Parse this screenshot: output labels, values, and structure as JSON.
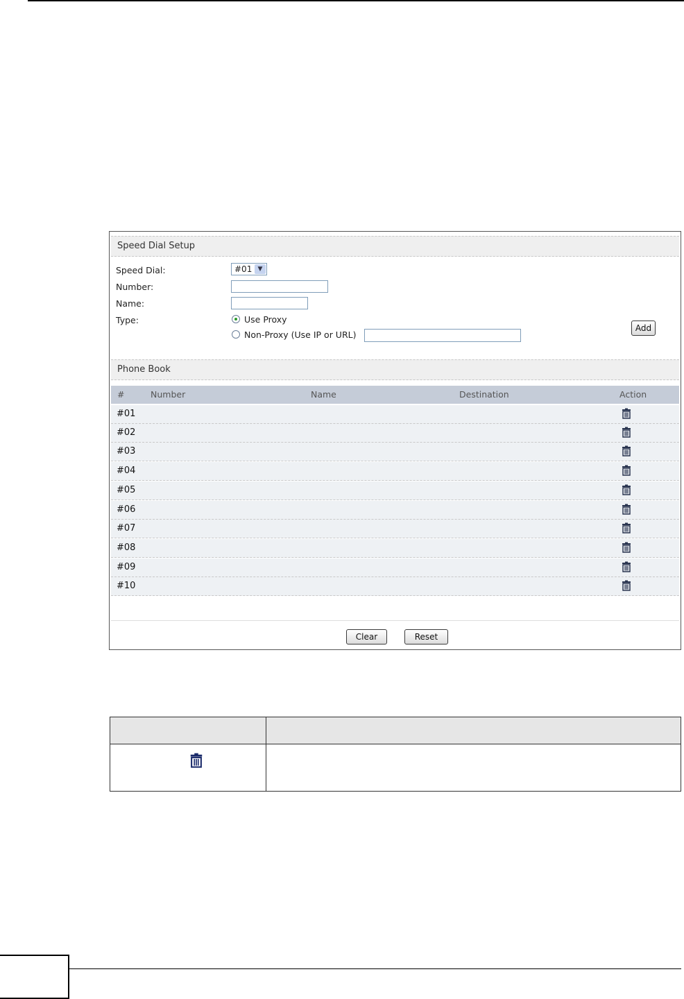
{
  "speed_dial_setup": {
    "header": "Speed Dial Setup",
    "speed_dial_label": "Speed Dial:",
    "speed_dial_value": "#01",
    "number_label": "Number:",
    "name_label": "Name:",
    "type_label": "Type:",
    "use_proxy_label": "Use Proxy",
    "use_proxy_selected": true,
    "non_proxy_label": "Non-Proxy (Use IP or URL)",
    "add_label": "Add"
  },
  "phone_book": {
    "header": "Phone Book",
    "columns": [
      "#",
      "Number",
      "Name",
      "Destination",
      "Action"
    ],
    "rows": [
      "#01",
      "#02",
      "#03",
      "#04",
      "#05",
      "#06",
      "#07",
      "#08",
      "#09",
      "#10"
    ]
  },
  "buttons": {
    "clear_label": "Clear",
    "reset_label": "Reset"
  },
  "description_table": {
    "icon": "trash-icon"
  }
}
